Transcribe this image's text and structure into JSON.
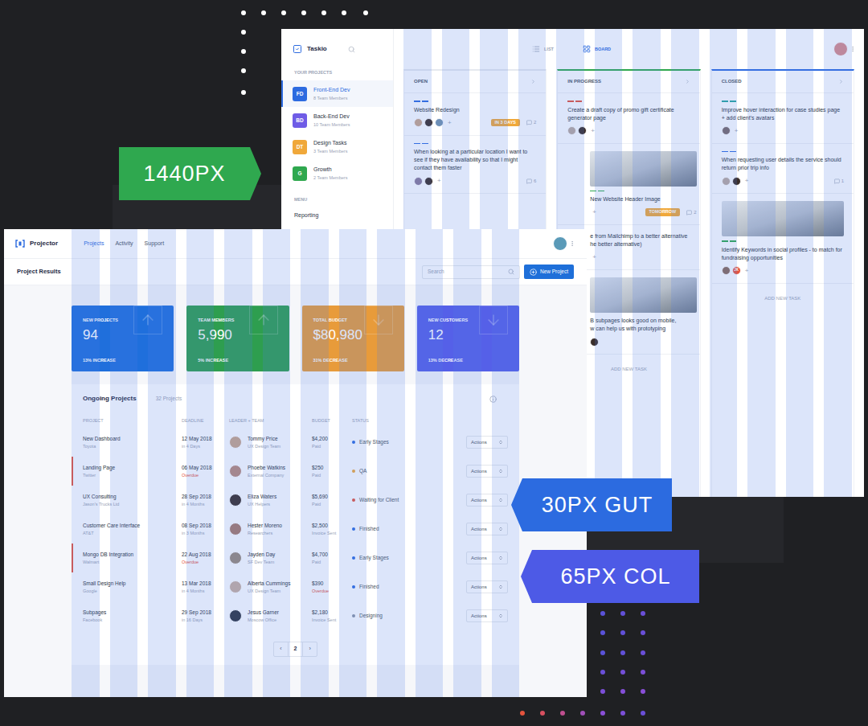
{
  "labels": [
    {
      "text": "1440PX",
      "kind": "pointer-right",
      "color": "#2fa84f"
    },
    {
      "text": "30PX GUT",
      "kind": "pointer-left",
      "color": "#2c6be0"
    },
    {
      "text": "65PX COL",
      "kind": "pointer-left",
      "color": "#4d5ae6"
    }
  ],
  "taskio": {
    "app_name": "Taskio",
    "view_tabs": [
      {
        "label": "LIST",
        "selected": false
      },
      {
        "label": "BOARD",
        "selected": true
      }
    ],
    "user_avatar": {
      "color": "#d98b8b"
    },
    "sidebar": {
      "heading": "YOUR PROJECTS",
      "projects": [
        {
          "initials": "FD",
          "name": "Front-End Dev",
          "members": "8 Team Members",
          "color": "#2d6be0",
          "selected": true
        },
        {
          "initials": "BD",
          "name": "Back-End Dev",
          "members": "10 Team Members",
          "color": "#6f5ce6",
          "selected": false
        },
        {
          "initials": "DT",
          "name": "Design Tasks",
          "members": "3 Team Members",
          "color": "#f0a83a",
          "selected": false
        },
        {
          "initials": "G",
          "name": "Growth",
          "members": "2 Team Members",
          "color": "#2fa84f",
          "selected": false
        }
      ],
      "menu_heading": "MENU",
      "menu_items": [
        "Reporting"
      ]
    },
    "columns": [
      {
        "title": "OPEN",
        "color": "#e6e9ef",
        "cards": [
          {
            "kind": "task",
            "clipped": false,
            "tag_color": "#2d6be0",
            "title": "Website Redesign",
            "avatars": [
              {
                "color": "#c9a58a"
              },
              {
                "color": "#3a2e2a"
              },
              {
                "color": "#6d8fb8"
              }
            ],
            "add": "+",
            "badge": "IN 3 DAYS",
            "comments": "2"
          },
          {
            "kind": "task",
            "clipped": false,
            "tag_color": "#2d6be0",
            "title": "When looking at a particular location I want to see if they have availability so that I might contact them faster",
            "avatars": [
              {
                "color": "#8a7a9a"
              },
              {
                "color": "#3a2e2a"
              }
            ],
            "add": "+",
            "comments": "6"
          }
        ]
      },
      {
        "title": "IN PROGRESS",
        "color": "#2fa84f",
        "add_task": "ADD NEW TASK",
        "cards": [
          {
            "kind": "task",
            "clipped": false,
            "tag_color": "#e5533d",
            "title": "Create a draft copy of promo gift certificate generator page",
            "avatars": [
              {
                "color": "#b9a9a0"
              },
              {
                "color": "#3a2e2a"
              }
            ],
            "add": "+"
          },
          {
            "kind": "image-task",
            "clipped": true,
            "tag_color": "#2fa84f",
            "title": "New Website Header Image",
            "avatars": [],
            "add": "+",
            "badge": "TOMORROW",
            "comments": "2"
          },
          {
            "kind": "task",
            "clipped": true,
            "lines": [
              "e from Mailchimp to a better alternative",
              "he better alternative)"
            ],
            "avatars": [],
            "add": "+"
          },
          {
            "kind": "image-task",
            "clipped": true,
            "lines": [
              "B subpages looks good on mobile,",
              "w can help us with prototyping"
            ],
            "avatars": [
              {
                "color": "#3a2e2a"
              }
            ]
          }
        ]
      },
      {
        "title": "CLOSED",
        "color": "#2d6be0",
        "add_task": "ADD NEW TASK",
        "cards": [
          {
            "kind": "task",
            "clipped": false,
            "tag_color": "#2aa5a0",
            "title": "Improve hover interaction for case studies page + add client's avatars",
            "avatars": [
              {
                "color": "#7a6a6a"
              }
            ],
            "add": "+"
          },
          {
            "kind": "task",
            "clipped": false,
            "tag_color": "#2d6be0",
            "title": "When requesting user details the service should return prior trip info",
            "avatars": [
              {
                "color": "#b9a9a0"
              },
              {
                "color": "#3a2e2a"
              }
            ],
            "add": "+",
            "comments": "1"
          },
          {
            "kind": "image-task",
            "clipped": false,
            "tag_color": "#2fa84f",
            "title": "Identify Keywords in social profiles - to match for fundraising opportunities",
            "avatars": [
              {
                "color": "#8a6a5a"
              },
              {
                "color": "#e5533d",
                "initials": "JK"
              }
            ],
            "add": "+"
          }
        ]
      }
    ]
  },
  "projector": {
    "app_name": "Projector",
    "nav": [
      {
        "label": "Projects",
        "selected": true
      },
      {
        "label": "Activity",
        "selected": false
      },
      {
        "label": "Support",
        "selected": false
      }
    ],
    "user_avatar": {
      "color": "#5a9ab8"
    },
    "page_title": "Project Results",
    "search": {
      "placeholder": "Search"
    },
    "new_button": "New Project",
    "stats": [
      {
        "title": "NEW PROJECTS",
        "value": "94",
        "change": "13% INCREASE",
        "trend": "up",
        "color": "#1f6fdc"
      },
      {
        "title": "TEAM MEMBERS",
        "value": "5,990",
        "change": "5% INCREASE",
        "trend": "up",
        "color": "#2e9e4f"
      },
      {
        "title": "TOTAL BUDGET",
        "value": "$80,980",
        "change": "31% DECREASE",
        "trend": "down",
        "color": "#e89b3a"
      },
      {
        "title": "NEW CUSTOMERS",
        "value": "12",
        "change": "13% DECREASE",
        "trend": "down",
        "color": "#5560e8"
      }
    ],
    "table": {
      "title": "Ongoing Projects",
      "count": "32 Projects",
      "columns": [
        "PROJECT",
        "DEADLINE",
        "LEADER + TEAM",
        "BUDGET",
        "STATUS"
      ],
      "rows": [
        {
          "project": "New Dashboard",
          "client": "Toyota",
          "deadline": "12 May 2018",
          "due": "in 4 Days",
          "overdue": false,
          "leader": "Tommy Price",
          "team": "UX Design Team",
          "avatar": "#c9a58a",
          "budget": "$4,200",
          "payment": "Paid",
          "payment_overdue": false,
          "status": "Early Stages",
          "status_color": "#2d6be0",
          "action": "Actions",
          "flagged": false
        },
        {
          "project": "Landing Page",
          "client": "Twitter",
          "deadline": "06 May 2018",
          "due": "Overdue",
          "overdue": true,
          "leader": "Phoebe Watkins",
          "team": "External Company",
          "avatar": "#b98a7a",
          "budget": "$250",
          "payment": "Paid",
          "payment_overdue": false,
          "status": "QA",
          "status_color": "#f0a83a",
          "action": "Actions",
          "flagged": true
        },
        {
          "project": "UX Consulting",
          "client": "Jason's Trucks Ltd",
          "deadline": "28 Sep 2018",
          "due": "in 4 Months",
          "overdue": false,
          "leader": "Eliza Waters",
          "team": "UX Helpers",
          "avatar": "#3a2e2a",
          "budget": "$5,690",
          "payment": "Paid",
          "payment_overdue": false,
          "status": "Waiting for Client",
          "status_color": "#e5533d",
          "action": "Actions",
          "flagged": false
        },
        {
          "project": "Customer Care Interface",
          "client": "AT&T",
          "deadline": "08 Sep 2018",
          "due": "in 3 Months",
          "overdue": false,
          "leader": "Hester Moreno",
          "team": "Researchers",
          "avatar": "#a87a6a",
          "budget": "$2,500",
          "payment": "Invoice Sent",
          "payment_overdue": false,
          "status": "Finished",
          "status_color": "#2d6be0",
          "action": "Actions",
          "flagged": false
        },
        {
          "project": "Mongo DB Integration",
          "client": "Walmart",
          "deadline": "22 Aug 2018",
          "due": "Overdue",
          "overdue": true,
          "leader": "Jayden Day",
          "team": "SF Dev Team",
          "avatar": "#9a8a7a",
          "budget": "$4,700",
          "payment": "Paid",
          "payment_overdue": false,
          "status": "Early Stages",
          "status_color": "#2d6be0",
          "action": "Actions",
          "flagged": true
        },
        {
          "project": "Small Design Help",
          "client": "Google",
          "deadline": "13 Mar 2018",
          "due": "in 4 Months",
          "overdue": false,
          "leader": "Alberta Cummings",
          "team": "UX Design Team",
          "avatar": "#c8b0a0",
          "budget": "$390",
          "payment": "Overdue",
          "payment_overdue": true,
          "status": "Finished",
          "status_color": "#2d6be0",
          "action": "Actions",
          "flagged": false
        },
        {
          "project": "Subpages",
          "client": "Facebook",
          "deadline": "29 Sep 2018",
          "due": "in 16 Days",
          "overdue": false,
          "leader": "Jesus Garner",
          "team": "Moscow Office",
          "avatar": "#2e3440",
          "budget": "$2,180",
          "payment": "Invoice Sent",
          "payment_overdue": false,
          "status": "Designing",
          "status_color": "#8a94a6",
          "action": "Actions",
          "flagged": false
        }
      ],
      "pagination": {
        "prev": "‹",
        "pages": [
          {
            "label": "2",
            "selected": true
          }
        ],
        "next": "›"
      }
    }
  }
}
